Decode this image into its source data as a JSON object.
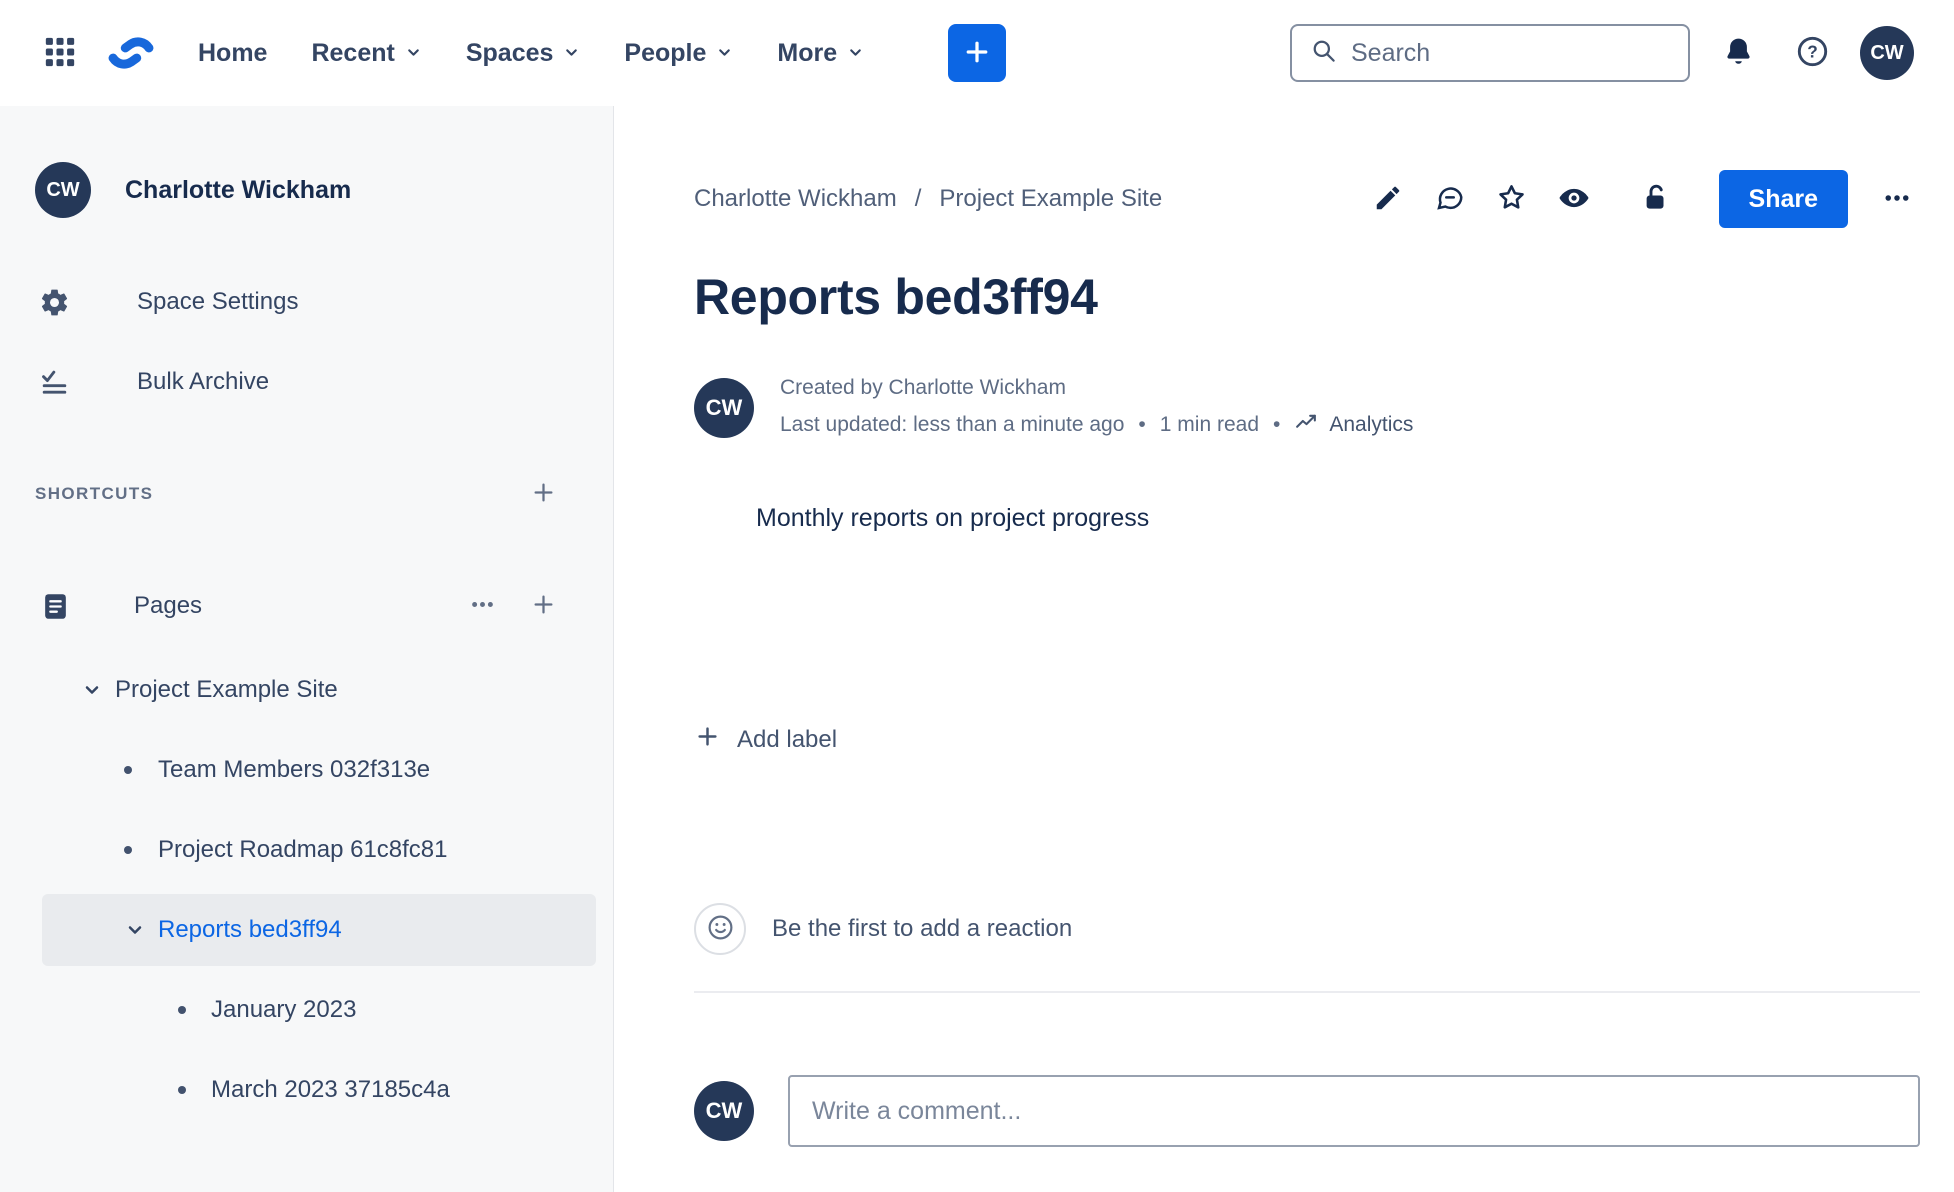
{
  "colors": {
    "accent_blue": "#0C66E4",
    "logo_blue": "#1868DB",
    "avatar_navy": "#253858",
    "sidebar_bg": "#F7F8F9",
    "selected_item_bg": "#E9EBEE",
    "text_dark": "#172B4D",
    "text_gray": "#5E6C84"
  },
  "icons": {
    "app-grid-icon": "3x3 grid",
    "confluence-logo": "blue double-wave mark",
    "plus-icon": "+",
    "search-icon": "magnifier",
    "notifications-icon": "bell",
    "help-icon": "question mark in circle",
    "gear-icon": "settings gear",
    "bulk-archive-icon": "check with list lines",
    "pages-icon": "document",
    "chevron-down-icon": "v",
    "edit-icon": "pencil",
    "comment-icon": "speech bubble",
    "star-icon": "star outline",
    "watch-icon": "eye",
    "unlock-icon": "open padlock",
    "more-icon": "ellipsis",
    "analytics-icon": "trend line",
    "smiley-icon": "smiley face"
  },
  "topbar": {
    "nav": [
      {
        "label": "Home",
        "dropdown": false
      },
      {
        "label": "Recent",
        "dropdown": true
      },
      {
        "label": "Spaces",
        "dropdown": true
      },
      {
        "label": "People",
        "dropdown": true
      },
      {
        "label": "More",
        "dropdown": true
      }
    ],
    "search_placeholder": "Search",
    "help_glyph": "?",
    "avatar_initials": "CW"
  },
  "sidebar": {
    "avatar_initials": "CW",
    "space_name": "Charlotte Wickham",
    "menu": [
      {
        "label": "Space Settings"
      },
      {
        "label": "Bulk Archive"
      }
    ],
    "shortcuts_label": "SHORTCUTS",
    "pages_label": "Pages",
    "tree": {
      "root": {
        "label": "Project Example Site"
      },
      "items": [
        {
          "label": "Team Members 032f313e",
          "selected": false
        },
        {
          "label": "Project Roadmap 61c8fc81",
          "selected": false
        },
        {
          "label": "Reports bed3ff94",
          "selected": true
        },
        {
          "label": "January 2023",
          "selected": false
        },
        {
          "label": "March 2023 37185c4a",
          "selected": false
        }
      ]
    }
  },
  "main": {
    "breadcrumb": {
      "items": [
        {
          "label": "Charlotte Wickham"
        },
        {
          "label": "Project Example Site"
        }
      ],
      "separator": "/"
    },
    "share_button": "Share",
    "title": "Reports bed3ff94",
    "byline": {
      "avatar_initials": "CW",
      "created": "Created by Charlotte Wickham",
      "updated": "Last updated: less than a minute ago",
      "separator": "•",
      "read_time": "1 min read",
      "analytics_label": "Analytics"
    },
    "body_text": "Monthly reports on project progress",
    "add_label_button": "Add label",
    "reactions_prompt": "Be the first to add a reaction",
    "comment": {
      "avatar_initials": "CW",
      "placeholder": "Write a comment..."
    }
  }
}
